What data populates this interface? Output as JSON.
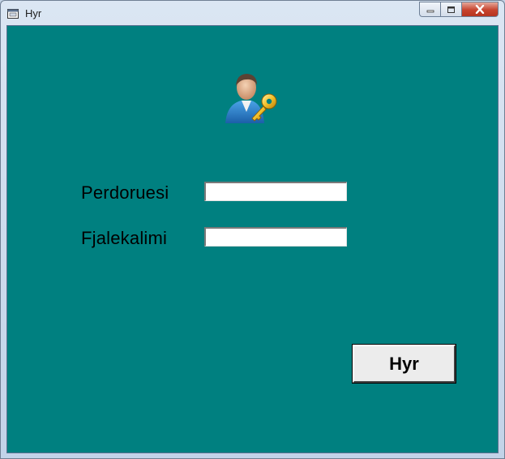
{
  "window": {
    "title": "Hyr"
  },
  "form": {
    "username_label": "Perdoruesi",
    "username_value": "",
    "password_label": "Fjalekalimi",
    "password_value": "",
    "submit_label": "Hyr"
  },
  "icons": {
    "app": "window-app-icon",
    "avatar": "user-key-icon"
  },
  "colors": {
    "client_bg": "#008080",
    "button_bg": "#ececec"
  }
}
